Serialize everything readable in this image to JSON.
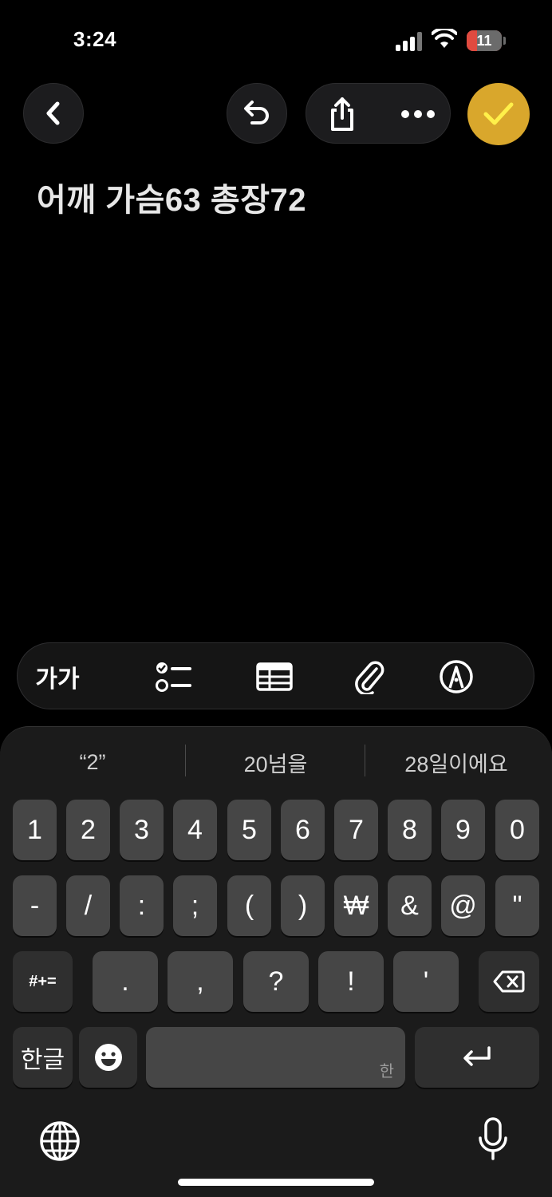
{
  "status": {
    "time": "3:24",
    "battery": "11"
  },
  "note": {
    "text": "어깨 가슴63 총장72"
  },
  "format_bar": {
    "text_style_label": "가가"
  },
  "keyboard": {
    "suggestions": [
      "“2”",
      "20넘을",
      "28일이에요"
    ],
    "row1": [
      "1",
      "2",
      "3",
      "4",
      "5",
      "6",
      "7",
      "8",
      "9",
      "0"
    ],
    "row2": [
      "-",
      "/",
      ":",
      ";",
      "(",
      ")",
      "₩",
      "&",
      "@",
      "\""
    ],
    "row3": [
      "#+=",
      ".",
      ",",
      "?",
      "!",
      "'"
    ],
    "hangul_label": "한글",
    "space_hint": "한"
  },
  "colors": {
    "accent": "#d9a72c",
    "key": "#464646",
    "background": "#000000"
  }
}
